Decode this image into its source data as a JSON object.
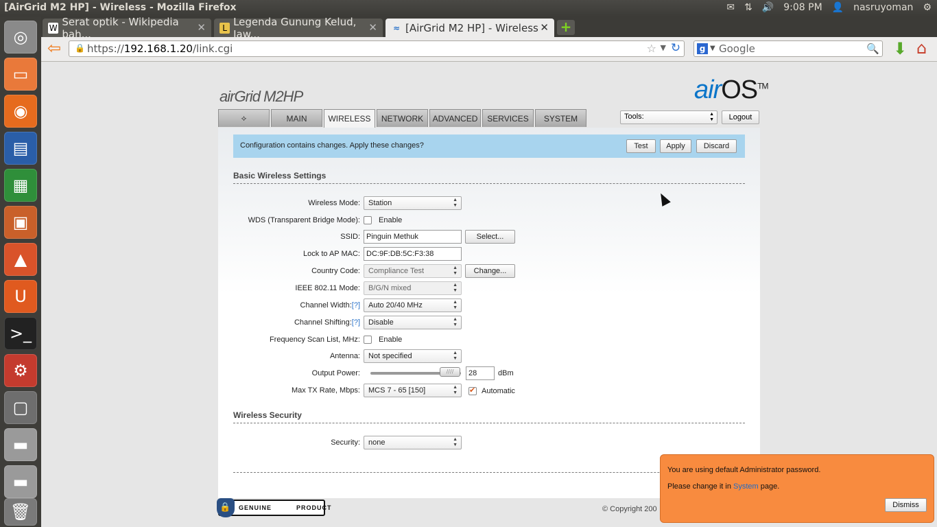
{
  "window": {
    "title": "[AirGrid M2 HP] - Wireless - Mozilla Firefox"
  },
  "panel": {
    "time": "9:08 PM",
    "user": "nasruyoman"
  },
  "browser": {
    "tabs": [
      {
        "label": "Serat optik - Wikipedia bah...",
        "icon": "W"
      },
      {
        "label": "Legenda Gunung Kelud, Jaw...",
        "icon": "L"
      },
      {
        "label": "[AirGrid M2 HP] - Wireless",
        "icon": "wifi"
      }
    ],
    "url_scheme": "https://",
    "url_host": "192.168.1.20",
    "url_path": "/link.cgi",
    "search_placeholder": "Google"
  },
  "page": {
    "product_logo": "airGrid M2HP",
    "os_logo_a": "air",
    "os_logo_b": "OS",
    "os_logo_tm": "TM",
    "nav_tabs": [
      "MAIN",
      "WIRELESS",
      "NETWORK",
      "ADVANCED",
      "SERVICES",
      "SYSTEM"
    ],
    "tools_label": "Tools:",
    "logout_label": "Logout",
    "notice": {
      "message": "Configuration contains changes. Apply these changes?",
      "test": "Test",
      "apply": "Apply",
      "discard": "Discard"
    },
    "basic_section": "Basic Wireless Settings",
    "fields": {
      "wireless_mode_label": "Wireless Mode:",
      "wireless_mode_value": "Station",
      "wds_label": "WDS (Transparent Bridge Mode):",
      "wds_enable": "Enable",
      "ssid_label": "SSID:",
      "ssid_value": "Pinguin Methuk",
      "select_btn": "Select...",
      "lock_mac_label": "Lock to AP MAC:",
      "lock_mac_value": "DC:9F:DB:5C:F3:38",
      "country_label": "Country Code:",
      "country_value": "Compliance Test",
      "change_btn": "Change...",
      "ieee_label": "IEEE 802.11 Mode:",
      "ieee_value": "B/G/N mixed",
      "chwidth_label": "Channel Width:",
      "chwidth_help": "[?]",
      "chwidth_value": "Auto 20/40 MHz",
      "chshift_label": "Channel Shifting:",
      "chshift_help": "[?]",
      "chshift_value": "Disable",
      "freqscan_label": "Frequency Scan List, MHz:",
      "freqscan_enable": "Enable",
      "antenna_label": "Antenna:",
      "antenna_value": "Not specified",
      "power_label": "Output Power:",
      "power_value": "28",
      "power_unit": "dBm",
      "maxtx_label": "Max TX Rate, Mbps:",
      "maxtx_value": "MCS 7 - 65 [150]",
      "maxtx_auto": "Automatic"
    },
    "security_section": "Wireless Security",
    "security_label": "Security:",
    "security_value": "none",
    "genuine_1": "GENUINE",
    "genuine_2": "PRODUCT",
    "copyright": "© Copyright 200"
  },
  "notification": {
    "line1": "You are using default Administrator password.",
    "line2_pre": "Please change it in ",
    "line2_link": "System",
    "line2_post": " page.",
    "dismiss": "Dismiss"
  },
  "colors": {
    "accent_blue": "#2b73c9",
    "notice_bg": "#a8d4ee",
    "notify_bg": "#f88b3f"
  }
}
